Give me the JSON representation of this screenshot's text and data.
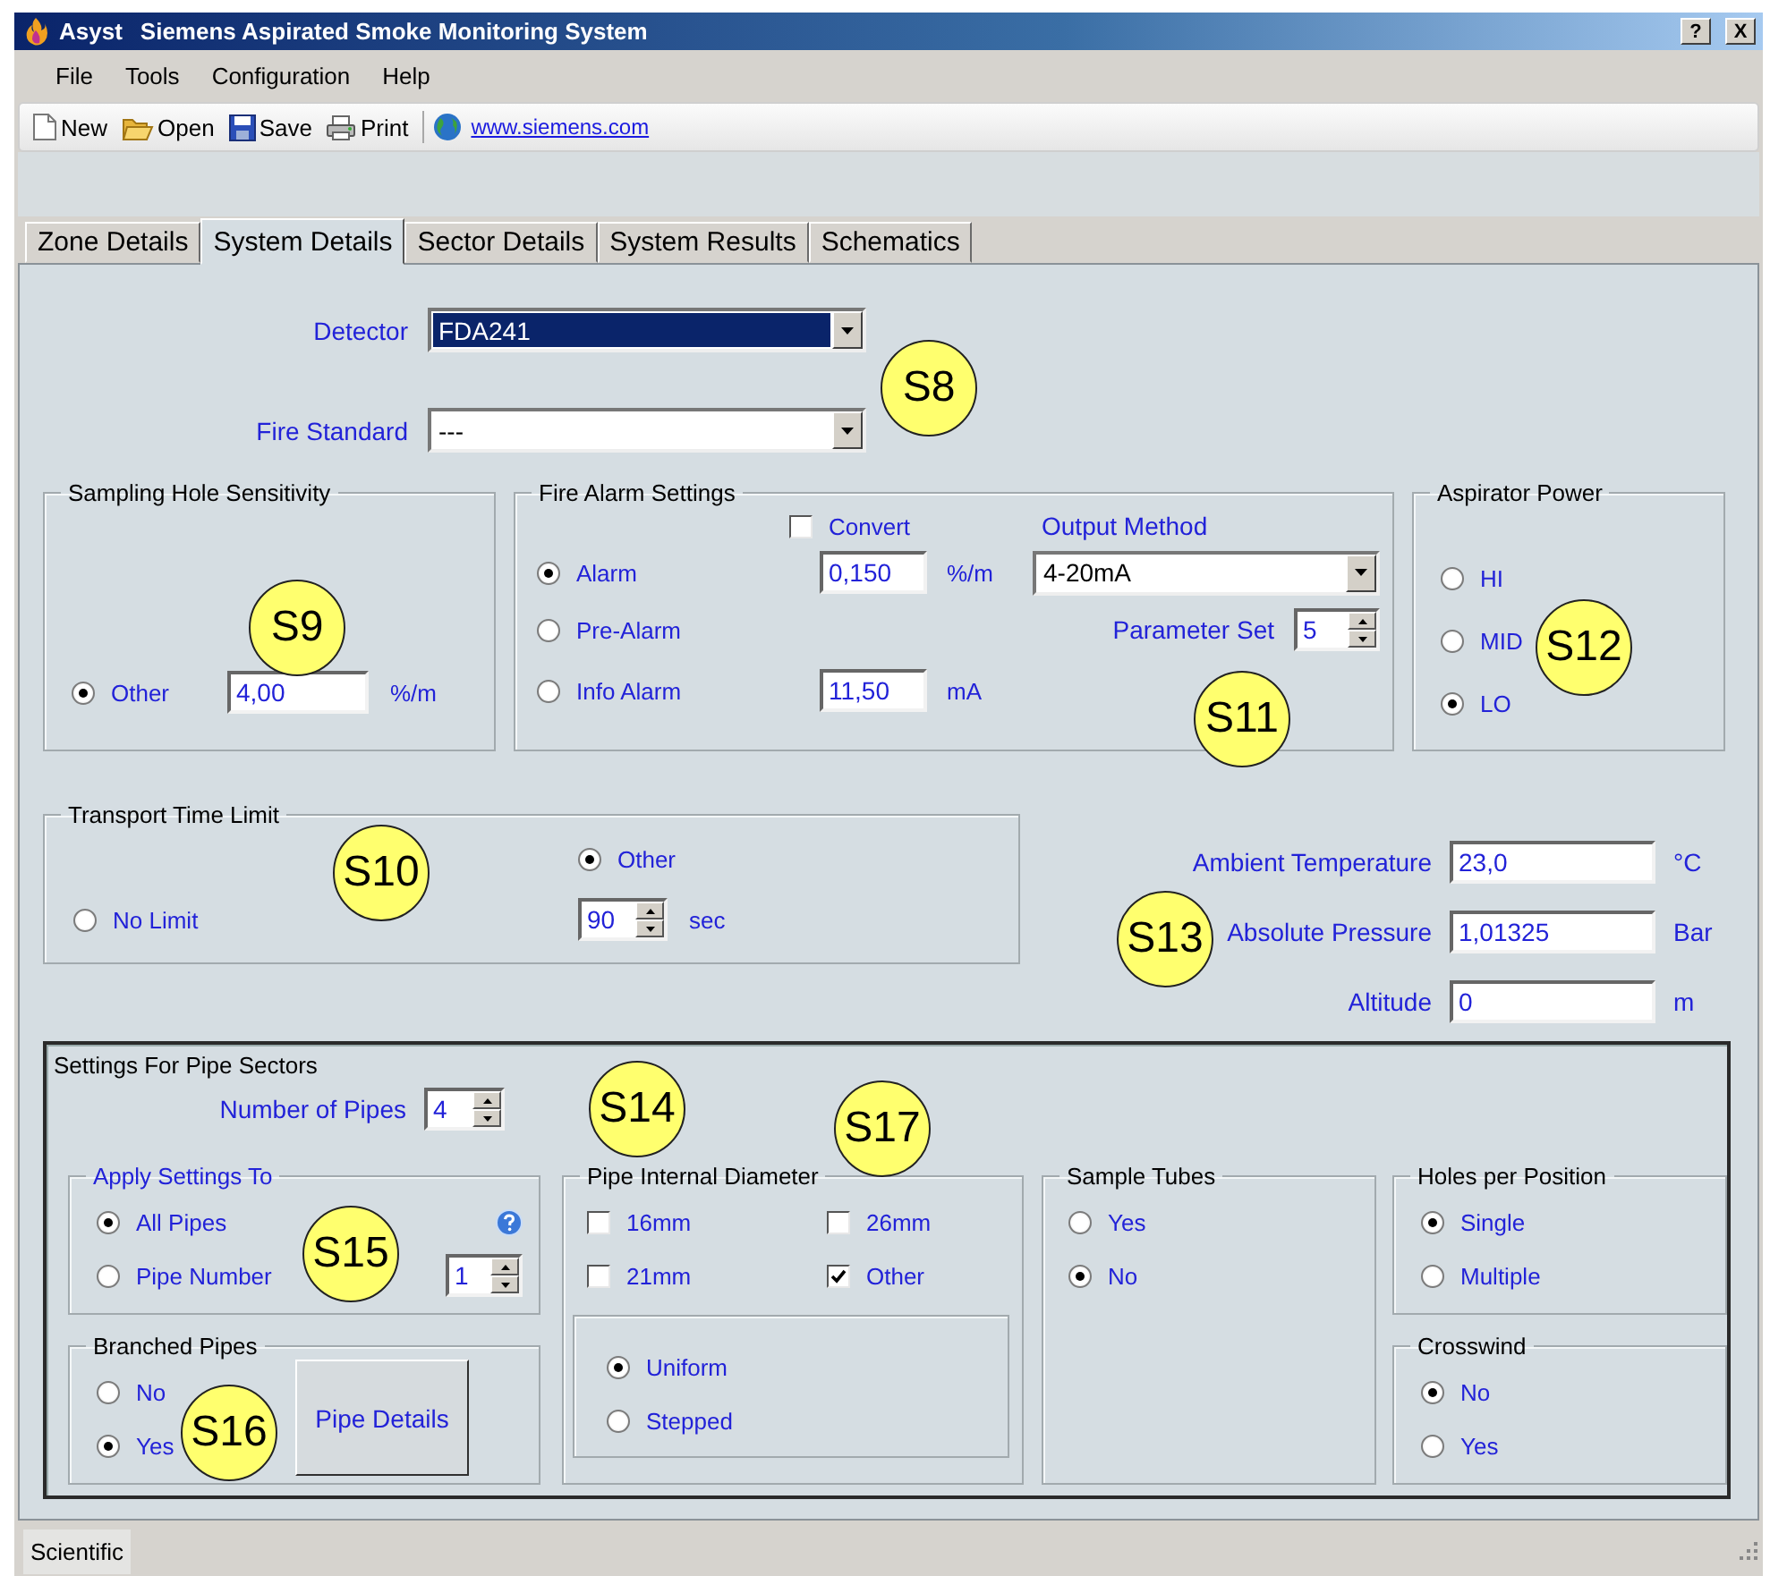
{
  "window": {
    "app_name": "Asyst",
    "title": "Siemens Aspirated Smoke Monitoring System",
    "controls": [
      {
        "kind": "help",
        "label": "?"
      },
      {
        "kind": "close",
        "label": "X"
      }
    ]
  },
  "menu": [
    "File",
    "Tools",
    "Configuration",
    "Help"
  ],
  "toolbar": [
    {
      "kind": "new",
      "label": "New"
    },
    {
      "kind": "open",
      "label": "Open"
    },
    {
      "kind": "save",
      "label": "Save"
    },
    {
      "kind": "print",
      "label": "Print"
    },
    {
      "kind": "link",
      "label": "www.siemens.com"
    }
  ],
  "tabs": [
    {
      "label": "Zone Details",
      "selected": false
    },
    {
      "label": "System Details",
      "selected": true
    },
    {
      "label": "Sector Details",
      "selected": false
    },
    {
      "label": "System Results",
      "selected": false
    },
    {
      "label": "Schematics",
      "selected": false
    }
  ],
  "detector": {
    "label": "Detector",
    "value": "FDA241",
    "highlighted": true
  },
  "fire_standard": {
    "label": "Fire Standard",
    "value": "---",
    "highlighted": false
  },
  "sampling_hole_sensitivity": {
    "title": "Sampling Hole Sensitivity",
    "option": {
      "label": "Other",
      "selected": true
    },
    "value": "4,00",
    "unit": "%/m"
  },
  "fire_alarm_settings": {
    "title": "Fire Alarm Settings",
    "convert": {
      "label": "Convert",
      "checked": false
    },
    "options": [
      {
        "label": "Alarm",
        "selected": true
      },
      {
        "label": "Pre-Alarm",
        "selected": false
      },
      {
        "label": "Info Alarm",
        "selected": false
      }
    ],
    "alarm_value": "0,150",
    "alarm_unit": "%/m",
    "info_value": "11,50",
    "info_unit": "mA",
    "output_method": {
      "label": "Output Method",
      "value": "4-20mA"
    },
    "parameter_set": {
      "label": "Parameter Set",
      "value": "5"
    }
  },
  "aspirator_power": {
    "title": "Aspirator Power",
    "options": [
      {
        "label": "HI",
        "selected": false
      },
      {
        "label": "MID",
        "selected": false
      },
      {
        "label": "LO",
        "selected": true
      }
    ]
  },
  "transport_time_limit": {
    "title": "Transport Time Limit",
    "options": [
      {
        "label": "No Limit",
        "selected": false
      },
      {
        "label": "Other",
        "selected": true
      }
    ],
    "value": "90",
    "unit": "sec"
  },
  "conditions": [
    {
      "label": "Ambient Temperature",
      "value": "23,0",
      "unit": "°C"
    },
    {
      "label": "Absolute Pressure",
      "value": "1,01325",
      "unit": "Bar"
    },
    {
      "label": "Altitude",
      "value": "0",
      "unit": "m"
    }
  ],
  "pipe_sectors": {
    "title": "Settings For Pipe Sectors",
    "number_of_pipes": {
      "label": "Number of Pipes",
      "value": "4"
    },
    "apply_settings_to": {
      "title": "Apply Settings To",
      "options": [
        {
          "label": "All Pipes",
          "selected": true
        },
        {
          "label": "Pipe Number",
          "selected": false
        }
      ],
      "pipe_number": "1"
    },
    "branched_pipes": {
      "title": "Branched Pipes",
      "options": [
        {
          "label": "No",
          "selected": false
        },
        {
          "label": "Yes",
          "selected": true
        }
      ],
      "button": "Pipe Details"
    },
    "pipe_internal_diameter": {
      "title": "Pipe Internal Diameter",
      "sizes": [
        {
          "label": "16mm",
          "checked": false
        },
        {
          "label": "26mm",
          "checked": false
        },
        {
          "label": "21mm",
          "checked": false
        },
        {
          "label": "Other",
          "checked": true
        }
      ],
      "profile": [
        {
          "label": "Uniform",
          "selected": true
        },
        {
          "label": "Stepped",
          "selected": false
        }
      ]
    },
    "sample_tubes": {
      "title": "Sample Tubes",
      "options": [
        {
          "label": "Yes",
          "selected": false
        },
        {
          "label": "No",
          "selected": true
        }
      ]
    },
    "holes_per_position": {
      "title": "Holes per Position",
      "options": [
        {
          "label": "Single",
          "selected": true
        },
        {
          "label": "Multiple",
          "selected": false
        }
      ]
    },
    "crosswind": {
      "title": "Crosswind",
      "options": [
        {
          "label": "No",
          "selected": true
        },
        {
          "label": "Yes",
          "selected": false
        }
      ]
    }
  },
  "callouts": [
    "S8",
    "S9",
    "S10",
    "S11",
    "S12",
    "S13",
    "S14",
    "S15",
    "S16",
    "S17"
  ],
  "status_bar": "Scientific"
}
